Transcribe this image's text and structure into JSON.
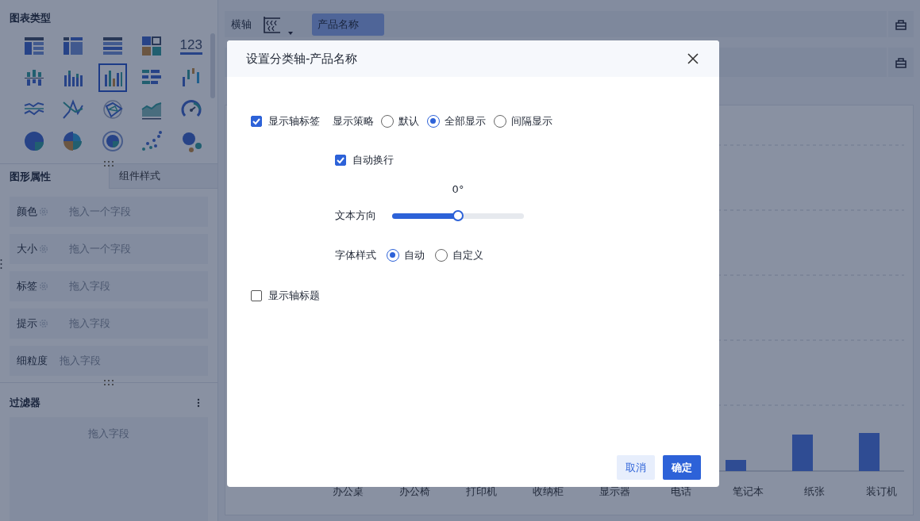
{
  "chart_types": {
    "title": "图表类型",
    "items": [
      {
        "kind": "table",
        "selected": false
      },
      {
        "kind": "cross-table",
        "selected": false
      },
      {
        "kind": "detail-table",
        "selected": false
      },
      {
        "kind": "dashboard",
        "selected": false
      },
      {
        "kind": "number",
        "label": "123",
        "selected": false
      },
      {
        "kind": "diverging-bar",
        "selected": false
      },
      {
        "kind": "stacked-bar",
        "selected": false
      },
      {
        "kind": "grouped-bar",
        "selected": true
      },
      {
        "kind": "horizontal-bar",
        "selected": false
      },
      {
        "kind": "waterfall",
        "selected": false
      },
      {
        "kind": "line",
        "selected": false
      },
      {
        "kind": "cross-line",
        "selected": false
      },
      {
        "kind": "radar",
        "selected": false
      },
      {
        "kind": "area",
        "selected": false
      },
      {
        "kind": "gauge",
        "selected": false
      },
      {
        "kind": "pie",
        "selected": false
      },
      {
        "kind": "rose",
        "selected": false
      },
      {
        "kind": "ring",
        "selected": false
      },
      {
        "kind": "scatter",
        "selected": false
      },
      {
        "kind": "bubble",
        "selected": false
      }
    ]
  },
  "property_tabs": [
    {
      "label": "图形属性",
      "selected": true
    },
    {
      "label": "组件样式",
      "selected": false
    }
  ],
  "property_fields": [
    {
      "label": "颜色",
      "settings": true,
      "placeholder": "拖入一个字段"
    },
    {
      "label": "大小",
      "settings": true,
      "placeholder": "拖入一个字段"
    },
    {
      "label": "标签",
      "settings": true,
      "placeholder": "拖入字段"
    },
    {
      "label": "提示",
      "settings": true,
      "placeholder": "拖入字段"
    },
    {
      "label": "细粒度",
      "settings": false,
      "placeholder": "拖入字段"
    }
  ],
  "filter": {
    "title": "过滤器",
    "placeholder": "拖入字段"
  },
  "axis_bar": {
    "label": "横轴",
    "field": "产品名称"
  },
  "chart": {
    "categories": [
      "办公桌",
      "办公椅",
      "打印机",
      "收纳柜",
      "显示器",
      "电话",
      "笔记本",
      "纸张",
      "装订机"
    ]
  },
  "dialog": {
    "title": "设置分类轴-产品名称",
    "show_labels": {
      "label": "显示轴标签",
      "checked": true
    },
    "strategy": {
      "label": "显示策略",
      "options": [
        {
          "label": "默认",
          "selected": false
        },
        {
          "label": "全部显示",
          "selected": true
        },
        {
          "label": "间隔显示",
          "selected": false
        }
      ]
    },
    "wrap": {
      "label": "自动换行",
      "checked": true
    },
    "direction": {
      "label": "文本方向",
      "reading": "0°",
      "level": 0.5
    },
    "font_style": {
      "label": "字体样式",
      "options": [
        {
          "label": "自动",
          "selected": true
        },
        {
          "label": "自定义",
          "selected": false
        }
      ]
    },
    "show_title": {
      "label": "显示轴标题",
      "checked": false
    },
    "buttons": [
      {
        "label": "取消",
        "kind": "secondary"
      },
      {
        "label": "确定",
        "kind": "primary"
      }
    ]
  }
}
